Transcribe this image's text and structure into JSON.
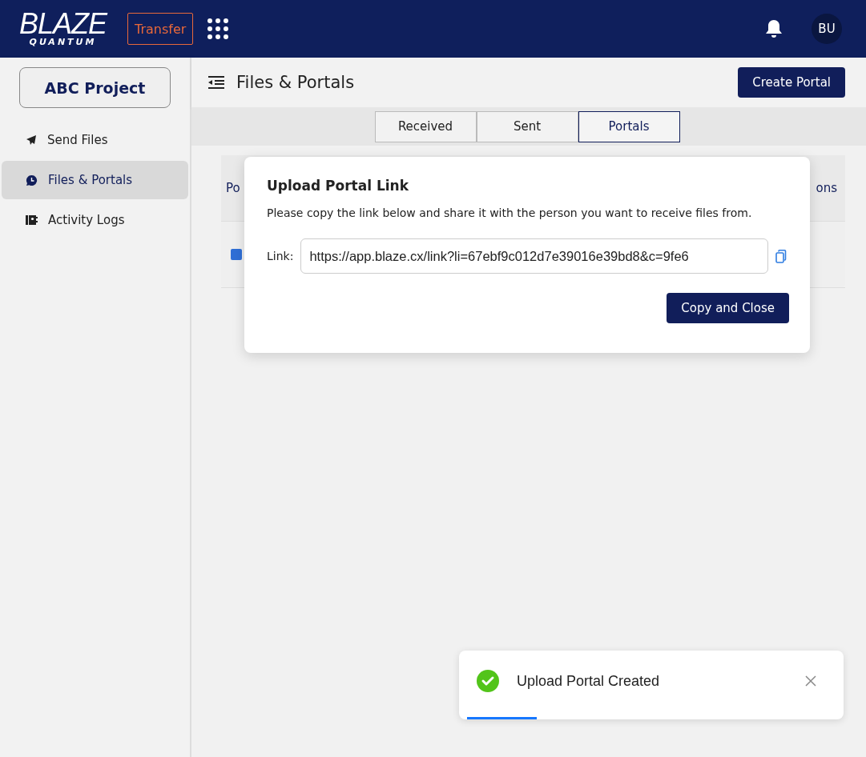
{
  "header": {
    "logo_main": "BLAZE",
    "logo_sub": "QUANTUM",
    "app_button": "Transfer",
    "avatar": "BU"
  },
  "sidebar": {
    "project": "ABC Project",
    "items": [
      {
        "label": "Send Files",
        "kind": "send",
        "selected": false
      },
      {
        "label": "Files & Portals",
        "kind": "clock",
        "selected": true
      },
      {
        "label": "Activity Logs",
        "kind": "log",
        "selected": false
      }
    ]
  },
  "page": {
    "title": "Files & Portals",
    "create_button": "Create Portal"
  },
  "tabs": [
    {
      "label": "Received",
      "selected": false
    },
    {
      "label": "Sent",
      "selected": false
    },
    {
      "label": "Portals",
      "selected": true
    }
  ],
  "table": {
    "column_1": "Po",
    "column_2": "ons"
  },
  "dialog": {
    "title": "Upload Portal Link",
    "message": "Please copy the link below and share it with the person you want to receive files from.",
    "link_label": "Link:",
    "link_value": "https://app.blaze.cx/link?li=67ebf9c012d7e39016e39bd8&c=9fe6",
    "button": "Copy and Close"
  },
  "toast": {
    "message": "Upload Portal Created",
    "level": 0.19
  }
}
